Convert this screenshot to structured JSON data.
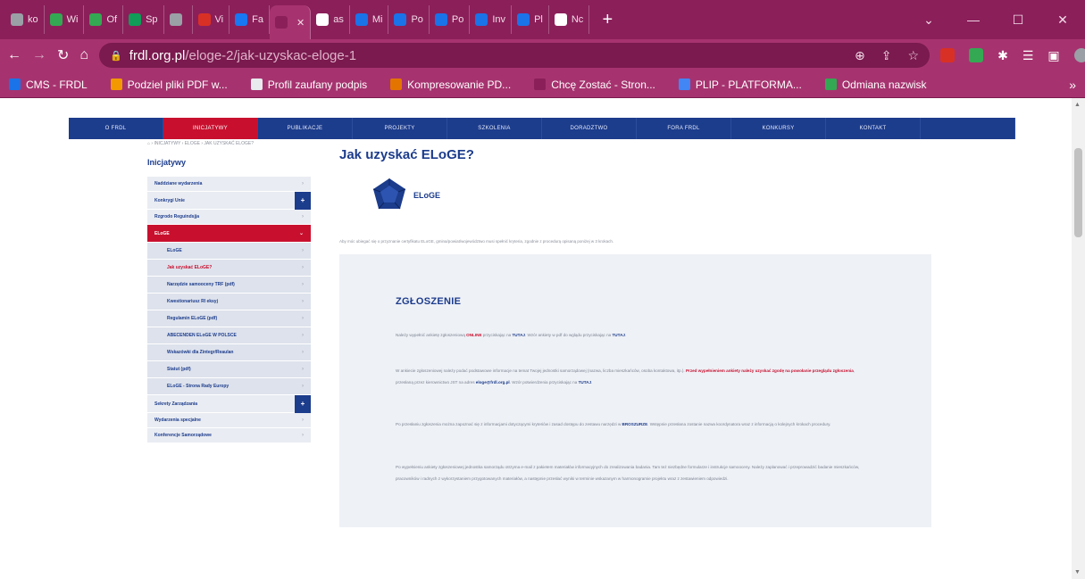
{
  "browser": {
    "tabs": [
      {
        "label": "ko",
        "color": "#9aa0a6"
      },
      {
        "label": "Wi",
        "color": "#34a853"
      },
      {
        "label": "Of",
        "color": "#34a853"
      },
      {
        "label": "Sp",
        "color": "#0f9d58"
      },
      {
        "label": "",
        "color": "#9aa0a6"
      },
      {
        "label": "Vi",
        "color": "#d93025"
      },
      {
        "label": "Fa",
        "color": "#1877f2"
      },
      {
        "label": "",
        "color": "#8b1f5a"
      },
      {
        "label": "as",
        "color": "#ffffff"
      },
      {
        "label": "Mi",
        "color": "#1a73e8"
      },
      {
        "label": "Po",
        "color": "#1a73e8"
      },
      {
        "label": "Po",
        "color": "#1a73e8"
      },
      {
        "label": "Inv",
        "color": "#1a73e8"
      },
      {
        "label": "Pl",
        "color": "#1a73e8"
      },
      {
        "label": "Nc",
        "color": "#ffffff"
      }
    ],
    "active_tab_close": "✕",
    "new_tab": "+",
    "url_host": "frdl.org.pl",
    "url_path": "/eloge-2/jak-uzyskac-eloge-1",
    "bookmarks": [
      {
        "label": "CMS - FRDL",
        "color": "#1a73e8"
      },
      {
        "label": "Podziel pliki PDF w...",
        "color": "#f29900"
      },
      {
        "label": "Profil zaufany podpis",
        "color": "#e8eaed"
      },
      {
        "label": "Kompresowanie PD...",
        "color": "#e37400"
      },
      {
        "label": "Chcę Zostać - Stron...",
        "color": "#8b1f5a"
      },
      {
        "label": "PLIP - PLATFORMA...",
        "color": "#4285f4"
      },
      {
        "label": "Odmiana nazwisk",
        "color": "#34a853"
      }
    ],
    "bookmarks_more": "»"
  },
  "site": {
    "nav": [
      "O FRDL",
      "INICJATYWY",
      "PUBLIKACJE",
      "PROJEKTY",
      "SZKOLENIA",
      "DORADZTWO",
      "FORA FRDL",
      "KONKURSY",
      "KONTAKT",
      ""
    ],
    "nav_active_index": 1,
    "breadcrumb": "⌂  ›  INICJATYWY  ›  ELOGE  ›  JAK UZYSKAĆ ELOGE?",
    "sidebar_title": "Inicjatywy",
    "sidebar": {
      "top": [
        "Naddziane wydarzenia",
        "Konkrygi Unie",
        "Rzgrodo Reguindsjja"
      ],
      "active": "ELoGE",
      "sub": [
        "ELoGE",
        "Jak uzyskać ELoGE?",
        "Narzędzie samooceny TRF (pdf)",
        "Kwestionariusz RI eksyj",
        "Regulamin ELoGE (pdf)",
        "ABECENDEN ELoGE W POLSCE",
        "Wskazówki dla Zintegr/Reaulan",
        "Statut (pdf)",
        "ELoGE - Strona Rady Europy"
      ],
      "current_sub_index": 1,
      "bottom": [
        "Sekrety Zarządzania",
        "Wydarzenia specjalne",
        "Konferencje Samorządowe"
      ]
    },
    "title": "Jak uzyskać ELoGE?",
    "logo_text": "ELoGE",
    "intro": "Aby móc ubiegać się o przyznanie certyfikatu ELoGE, gmina/powiat/województwo musi spełnić kryteria, zgodnie z procedurą opisaną poniżej w 3 krokach.",
    "section_heading": "ZGŁOSZENIE",
    "para1": {
      "a": "Należy wypełnić ankietę zgłoszeniową ",
      "online": "ONLINE",
      "b": " przyciskając na ",
      "link1": "TUTAJ",
      "c": ". Wzór ankiety w pdf do wglądu przyciskając na ",
      "link2": "TUTAJ",
      "d": "."
    },
    "para2": {
      "a": "W ankiecie zgłoszeniowej należy podać podstawowe informacje na temat Twojej jednostki samorządowej (nazwa, liczba mieszkańców, osoba kontaktowa, itp.). ",
      "red": "Przed wypełnieniem ankiety należy uzyskać zgodę na powołanie przeglądu zgłoszenia",
      "b": ", przesłaną przez kierownictwo JST na adres ",
      "email": "eloge@frdl.org.pl",
      "c": ". Wzór potwierdzenia przyciskając na ",
      "link": "TUTAJ",
      "d": "."
    },
    "para3": {
      "a": "Po przesłaniu zgłoszenia można zapoznać się z informacjami dotyczącymi kryteriów i zasad dostępu do zestawu narzędzi w ",
      "b": "BROSZURZE",
      "c": ". Wstępnie przesłana zostanie nazwa koordynatora wraz z informacją o kolejnych krokach procedury."
    },
    "para4": "Po wypełnieniu ankiety zgłoszeniowej jednostka samorządu otrzyma e-mail z pakietem materiałów informacyjnych do zrealizowania badania. Tam też niezbędne formularze i instrukcje samooceny. Należy zaplanować i przeprowadzić badanie mieszkańców, pracowników i radnych z wykorzystaniem przygotowanych materiałów, a następnie przesłać wyniki w terminie wskazanym w harmonogramie projektu wraz z zestawieniem odpowiedzi."
  }
}
